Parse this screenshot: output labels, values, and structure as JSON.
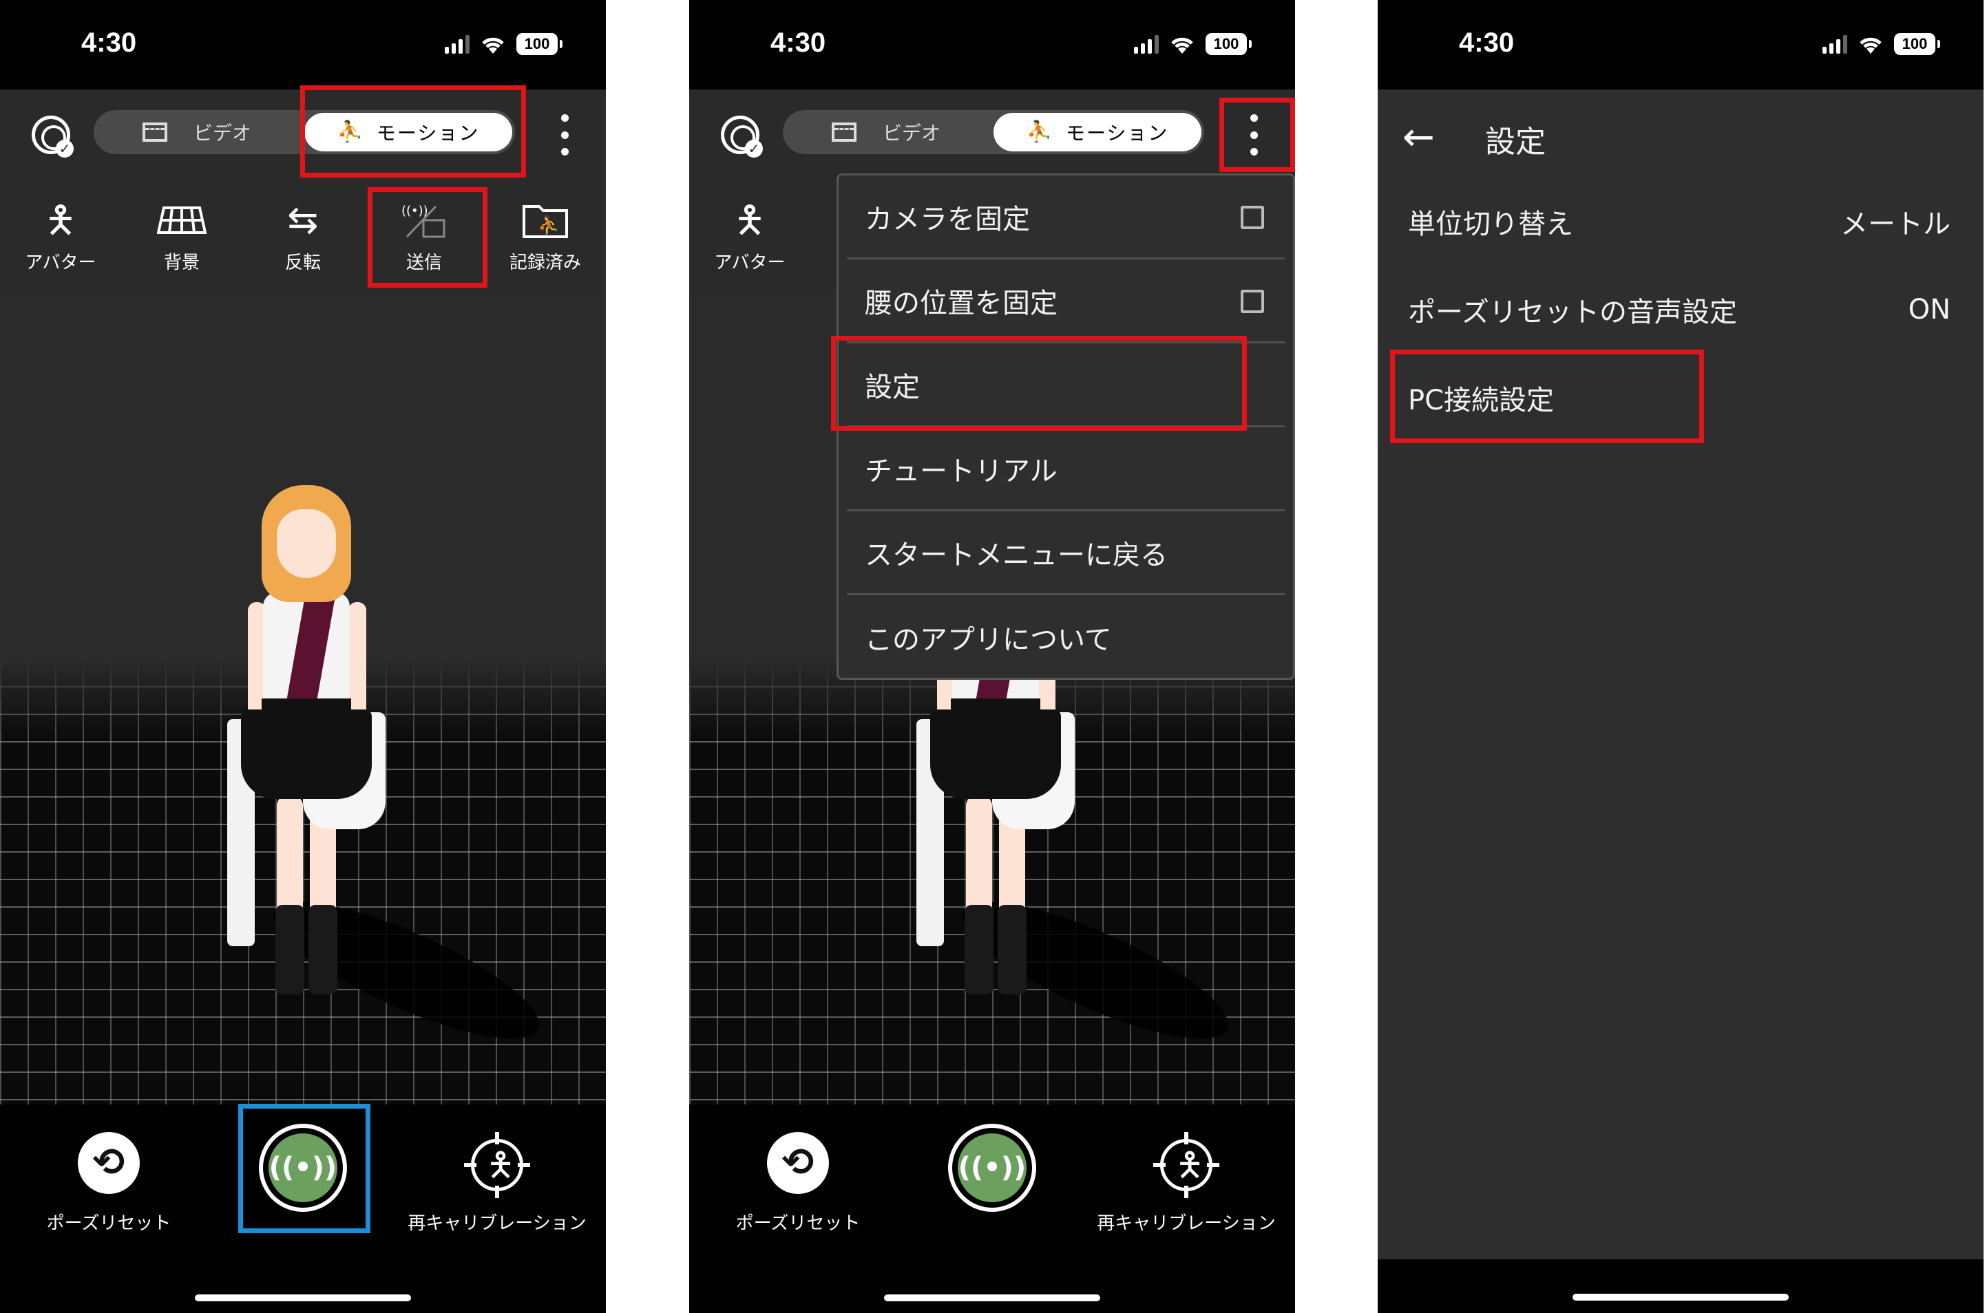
{
  "status_bar": {
    "time": "4:30",
    "battery": "100"
  },
  "top_bar": {
    "video_label": "ビデオ",
    "motion_label": "モーション"
  },
  "tools": [
    {
      "label": "アバター",
      "icon": "person-icon"
    },
    {
      "label": "背景",
      "icon": "grid-floor-icon"
    },
    {
      "label": "反転",
      "icon": "swap-arrows-icon"
    },
    {
      "label": "送信",
      "icon": "broadcast-folder-icon"
    },
    {
      "label": "記録済み",
      "icon": "recorded-folder-icon"
    }
  ],
  "bottom_controls": {
    "pose_reset_label": "ポーズリセット",
    "recalibrate_label": "再キャリブレーション"
  },
  "menu": {
    "items": [
      {
        "label": "カメラを固定",
        "checkbox": true,
        "checked": false
      },
      {
        "label": "腰の位置を固定",
        "checkbox": true,
        "checked": false
      },
      {
        "label": "設定",
        "checkbox": false
      },
      {
        "label": "チュートリアル",
        "checkbox": false
      },
      {
        "label": "スタートメニューに戻る",
        "checkbox": false
      },
      {
        "label": "このアプリについて",
        "checkbox": false
      }
    ]
  },
  "settings": {
    "title": "設定",
    "rows": [
      {
        "label": "単位切り替え",
        "value": "メートル"
      },
      {
        "label": "ポーズリセットの音声設定",
        "value": "ON"
      },
      {
        "label": "PC接続設定",
        "value": ""
      }
    ]
  },
  "colors": {
    "highlight_red": "#e0151b",
    "highlight_blue": "#1a90d8",
    "broadcast_green": "#6ba05f",
    "panel_bg": "#2a2a2a"
  }
}
